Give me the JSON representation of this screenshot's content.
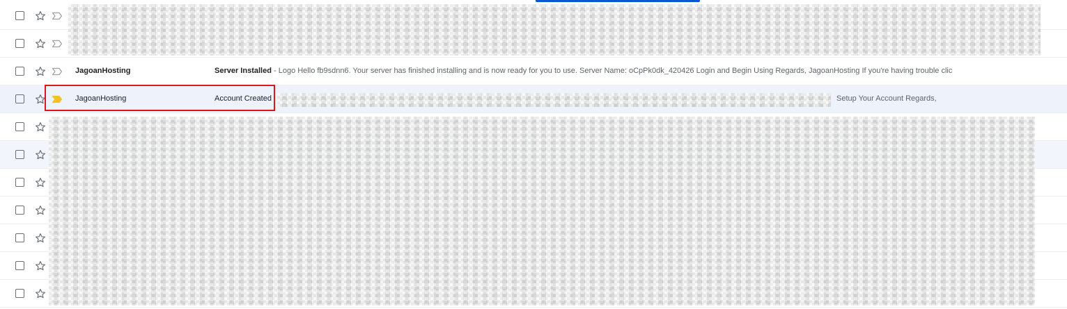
{
  "inbox": {
    "row_count": 11,
    "rows": [
      {
        "sender": "",
        "subject": "",
        "snippet": "",
        "tail": "",
        "unread": false,
        "important": false,
        "background": "read"
      },
      {
        "sender": "",
        "subject": "",
        "snippet": "",
        "tail": "",
        "unread": false,
        "important": false,
        "background": "read"
      },
      {
        "sender": "JagoanHosting",
        "subject": "Server Installed",
        "snippet": " - Logo Hello fb9sdnn6. Your server has finished installing and is now ready for you to use. Server Name: oCpPk0dk_420426 Login and Begin Using Regards, JagoanHosting If you're having trouble clicking",
        "tail": "",
        "unread": true,
        "important": false,
        "background": "read"
      },
      {
        "sender": "JagoanHosting",
        "subject": "Account Created",
        "snippet": "",
        "tail": "Setup Your Account Regards,",
        "unread": false,
        "important": true,
        "background": "highlight"
      },
      {
        "sender": "",
        "subject": "",
        "snippet": "",
        "tail": "",
        "unread": false,
        "important": false,
        "background": "read"
      },
      {
        "sender": "",
        "subject": "",
        "snippet": "",
        "tail": "",
        "unread": false,
        "important": false,
        "background": "alt"
      },
      {
        "sender": "",
        "subject": "",
        "snippet": "",
        "tail": "",
        "unread": false,
        "important": false,
        "background": "read"
      },
      {
        "sender": "",
        "subject": "",
        "snippet": "",
        "tail": "",
        "unread": false,
        "important": false,
        "background": "read"
      },
      {
        "sender": "",
        "subject": "",
        "snippet": "",
        "tail": "",
        "unread": false,
        "important": false,
        "background": "read"
      },
      {
        "sender": "",
        "subject": "",
        "snippet": "",
        "tail": "",
        "unread": false,
        "important": false,
        "background": "read"
      },
      {
        "sender": "",
        "subject": "",
        "snippet": "",
        "tail": "",
        "unread": false,
        "important": false,
        "background": "read"
      }
    ]
  },
  "colors": {
    "active_tab_indicator": "#0b57d0",
    "highlight_border": "#e1141b",
    "important_marker": "#f6bf26",
    "important_marker_off": "#9aa0a6",
    "row_highlight_bg": "#eef2fb",
    "row_alt_bg": "#f2f6fc"
  },
  "icons": {
    "checkbox": "checkbox-icon",
    "star": "star-icon",
    "important": "important-marker-icon"
  },
  "annotations": {
    "highlighted_row_index": 3
  }
}
